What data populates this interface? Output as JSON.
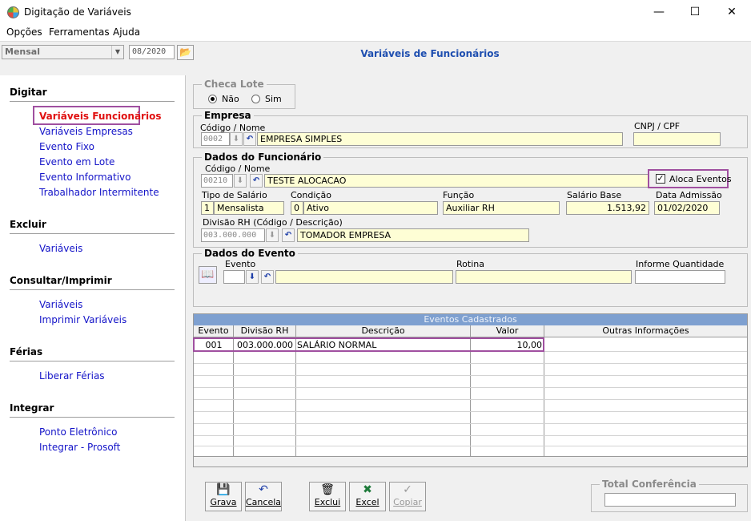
{
  "window": {
    "title": "Digitação de Variáveis",
    "controls": {
      "minimize": "—",
      "maximize": "☐",
      "close": "✕"
    }
  },
  "menu": [
    "Opções",
    "Ferramentas",
    "Ajuda"
  ],
  "toolbar": {
    "period": "Mensal",
    "date": "08/2020",
    "title": "Variáveis de Funcionários"
  },
  "sidebar": {
    "sections": [
      {
        "heading": "Digitar",
        "items": [
          "Variáveis Funcionários",
          "Variáveis Empresas",
          "Evento Fixo",
          "Evento em Lote",
          "Evento Informativo",
          "Trabalhador Intermitente"
        ]
      },
      {
        "heading": "Excluir",
        "items": [
          "Variáveis"
        ]
      },
      {
        "heading": "Consultar/Imprimir",
        "items": [
          "Variáveis",
          "Imprimir Variáveis"
        ]
      },
      {
        "heading": "Férias",
        "items": [
          "Liberar Férias"
        ]
      },
      {
        "heading": "Integrar",
        "items": [
          "Ponto Eletrônico",
          "Integrar - Prosoft"
        ]
      }
    ],
    "active_item": "Variáveis Funcionários"
  },
  "checa_lote": {
    "legend": "Checa Lote",
    "option_nao": "Não",
    "option_sim": "Sim",
    "selected": "Não"
  },
  "empresa": {
    "legend": "Empresa",
    "codigo_label": "Código / Nome",
    "codigo": "0002",
    "nome": "EMPRESA SIMPLES",
    "cnpj_label": "CNPJ / CPF",
    "cnpj": ""
  },
  "funcionario": {
    "legend": "Dados do Funcionário",
    "codigo_label": "Código / Nome",
    "codigo": "00210",
    "nome": "TESTE ALOCACAO",
    "aloca_label": "Aloca Eventos",
    "aloca_checked": true,
    "tipo_label": "Tipo de Salário",
    "tipo_code": "1",
    "tipo_value": "Mensalista",
    "condicao_label": "Condição",
    "condicao_code": "0",
    "condicao_value": "Ativo",
    "funcao_label": "Função",
    "funcao_value": "Auxiliar RH",
    "salario_label": "Salário Base",
    "salario_value": "1.513,92",
    "admissao_label": "Data Admissão",
    "admissao_value": "01/02/2020",
    "divisao_label": "Divisão RH (Código / Descrição)",
    "divisao_code": "003.000.000",
    "divisao_desc": "TOMADOR EMPRESA"
  },
  "evento": {
    "legend": "Dados do Evento",
    "evento_label": "Evento",
    "rotina_label": "Rotina",
    "quantidade_label": "Informe Quantidade"
  },
  "grid": {
    "caption": "Eventos Cadastrados",
    "columns": [
      "Evento",
      "Divisão RH",
      "Descrição",
      "Valor",
      "Outras Informações"
    ],
    "rows": [
      [
        "001",
        "003.000.000",
        "SALÁRIO NORMAL",
        "10,00",
        ""
      ]
    ]
  },
  "buttons": [
    {
      "label": "Grava",
      "icon": "save-icon"
    },
    {
      "label": "Cancela",
      "icon": "undo-icon"
    },
    {
      "label": "Exclui",
      "icon": "trash-icon"
    },
    {
      "label": "Excel",
      "icon": "excel-icon"
    },
    {
      "label": "Copiar",
      "icon": "check-icon",
      "disabled": true
    }
  ],
  "total": {
    "legend": "Total Conferência",
    "value": ""
  },
  "colors": {
    "accent": "#1f4fb0",
    "link": "#1414c8",
    "active_link": "#e01010",
    "highlight_border": "#a050a0",
    "field_bg": "#fefed5",
    "grid_caption": "#7ea0d0"
  }
}
